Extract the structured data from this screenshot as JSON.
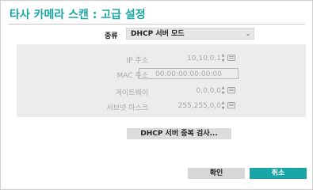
{
  "dialog": {
    "title": "타사 카메라 스캔 : 고급 설정"
  },
  "type_field": {
    "label": "종류",
    "value": "DHCP 서버 모드",
    "arrow_icon": "chevron-down-icon"
  },
  "network": {
    "ip": {
      "label": "IP 주소",
      "value": "10,10,0,1"
    },
    "mac": {
      "label": "MAC 주소",
      "value": "00:00:00:00:00:00"
    },
    "gateway": {
      "label": "게이트웨이",
      "value": "0,0,0,0"
    },
    "subnet": {
      "label": "서브넷 마스크",
      "value": "255,255,0,0"
    }
  },
  "buttons": {
    "scan_check": "DHCP 서버 중복 검사...",
    "ok": "확인",
    "cancel": "취소"
  },
  "colors": {
    "accent": "#1aa6a6",
    "panel_bg": "#ececec",
    "disabled_text": "#a8a8a8"
  }
}
